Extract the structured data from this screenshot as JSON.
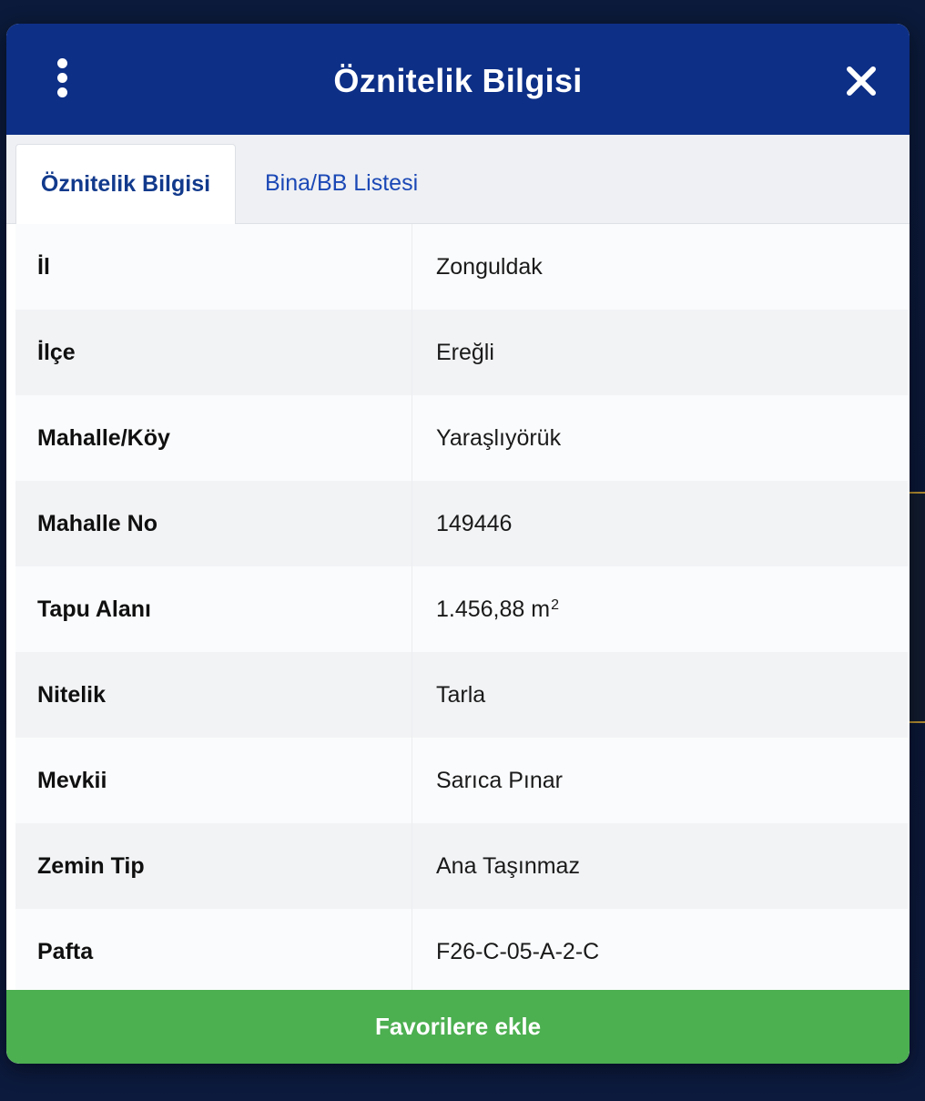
{
  "dialog": {
    "title": "Öznitelik Bilgisi",
    "menu_icon": "more-vertical-icon",
    "close_icon": "close-icon"
  },
  "tabs": [
    {
      "label": "Öznitelik Bilgisi",
      "active": true
    },
    {
      "label": "Bina/BB Listesi",
      "active": false
    }
  ],
  "attributes": [
    {
      "key": "İl",
      "value": "Zonguldak"
    },
    {
      "key": "İlçe",
      "value": "Ereğli"
    },
    {
      "key": "Mahalle/Köy",
      "value": "Yaraşlıyörük"
    },
    {
      "key": "Mahalle No",
      "value": "149446"
    },
    {
      "key": "Tapu Alanı",
      "value": "1.456,88 m",
      "unit_superscript": "2"
    },
    {
      "key": "Nitelik",
      "value": "Tarla"
    },
    {
      "key": "Mevkii",
      "value": "Sarıca Pınar"
    },
    {
      "key": "Zemin Tip",
      "value": "Ana Taşınmaz"
    },
    {
      "key": "Pafta",
      "value": "F26-C-05-A-2-C"
    }
  ],
  "actions": {
    "favorite_label": "Favorilere ekle"
  },
  "colors": {
    "header_bg": "#0d2f86",
    "active_tab_text": "#123a8c",
    "inactive_tab_text": "#1b48b6",
    "button_bg": "#4caf50"
  }
}
